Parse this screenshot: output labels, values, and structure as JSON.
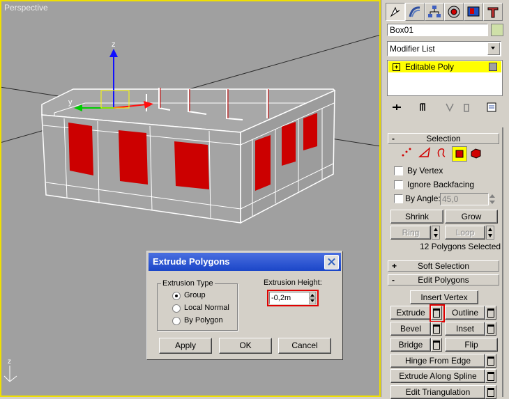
{
  "viewport": {
    "label": "Perspective",
    "axis_z": "z",
    "gizmo_z": "z",
    "gizmo_y": "y"
  },
  "panel": {
    "object_name": "Box01",
    "modifier_list": "Modifier List",
    "stack_item": "Editable Poly",
    "selection": {
      "title": "Selection",
      "by_vertex": "By Vertex",
      "ignore_backfacing": "Ignore Backfacing",
      "by_angle": "By Angle:",
      "angle_value": "45,0",
      "shrink": "Shrink",
      "grow": "Grow",
      "ring": "Ring",
      "loop": "Loop",
      "status": "12 Polygons Selected"
    },
    "soft_selection": {
      "title": "Soft Selection",
      "sign": "+"
    },
    "edit_polygons": {
      "title": "Edit Polygons",
      "sign": "-",
      "insert_vertex": "Insert Vertex",
      "extrude": "Extrude",
      "outline": "Outline",
      "bevel": "Bevel",
      "inset": "Inset",
      "bridge": "Bridge",
      "flip": "Flip",
      "hinge": "Hinge From Edge",
      "extrude_spline": "Extrude Along Spline",
      "edit_triangulation": "Edit Triangulation"
    }
  },
  "dialog": {
    "title": "Extrude Polygons",
    "group_label": "Extrusion Type",
    "options": [
      "Group",
      "Local Normal",
      "By Polygon"
    ],
    "selected_option": "Group",
    "height_label": "Extrusion Height:",
    "height_value": "-0,2m",
    "apply": "Apply",
    "ok": "OK",
    "cancel": "Cancel"
  },
  "colors": {
    "viewport_bg": "#a0a0a0",
    "selection_red": "#cc0000",
    "highlight": "#ffff00",
    "title_blue": "#1b46c8"
  }
}
